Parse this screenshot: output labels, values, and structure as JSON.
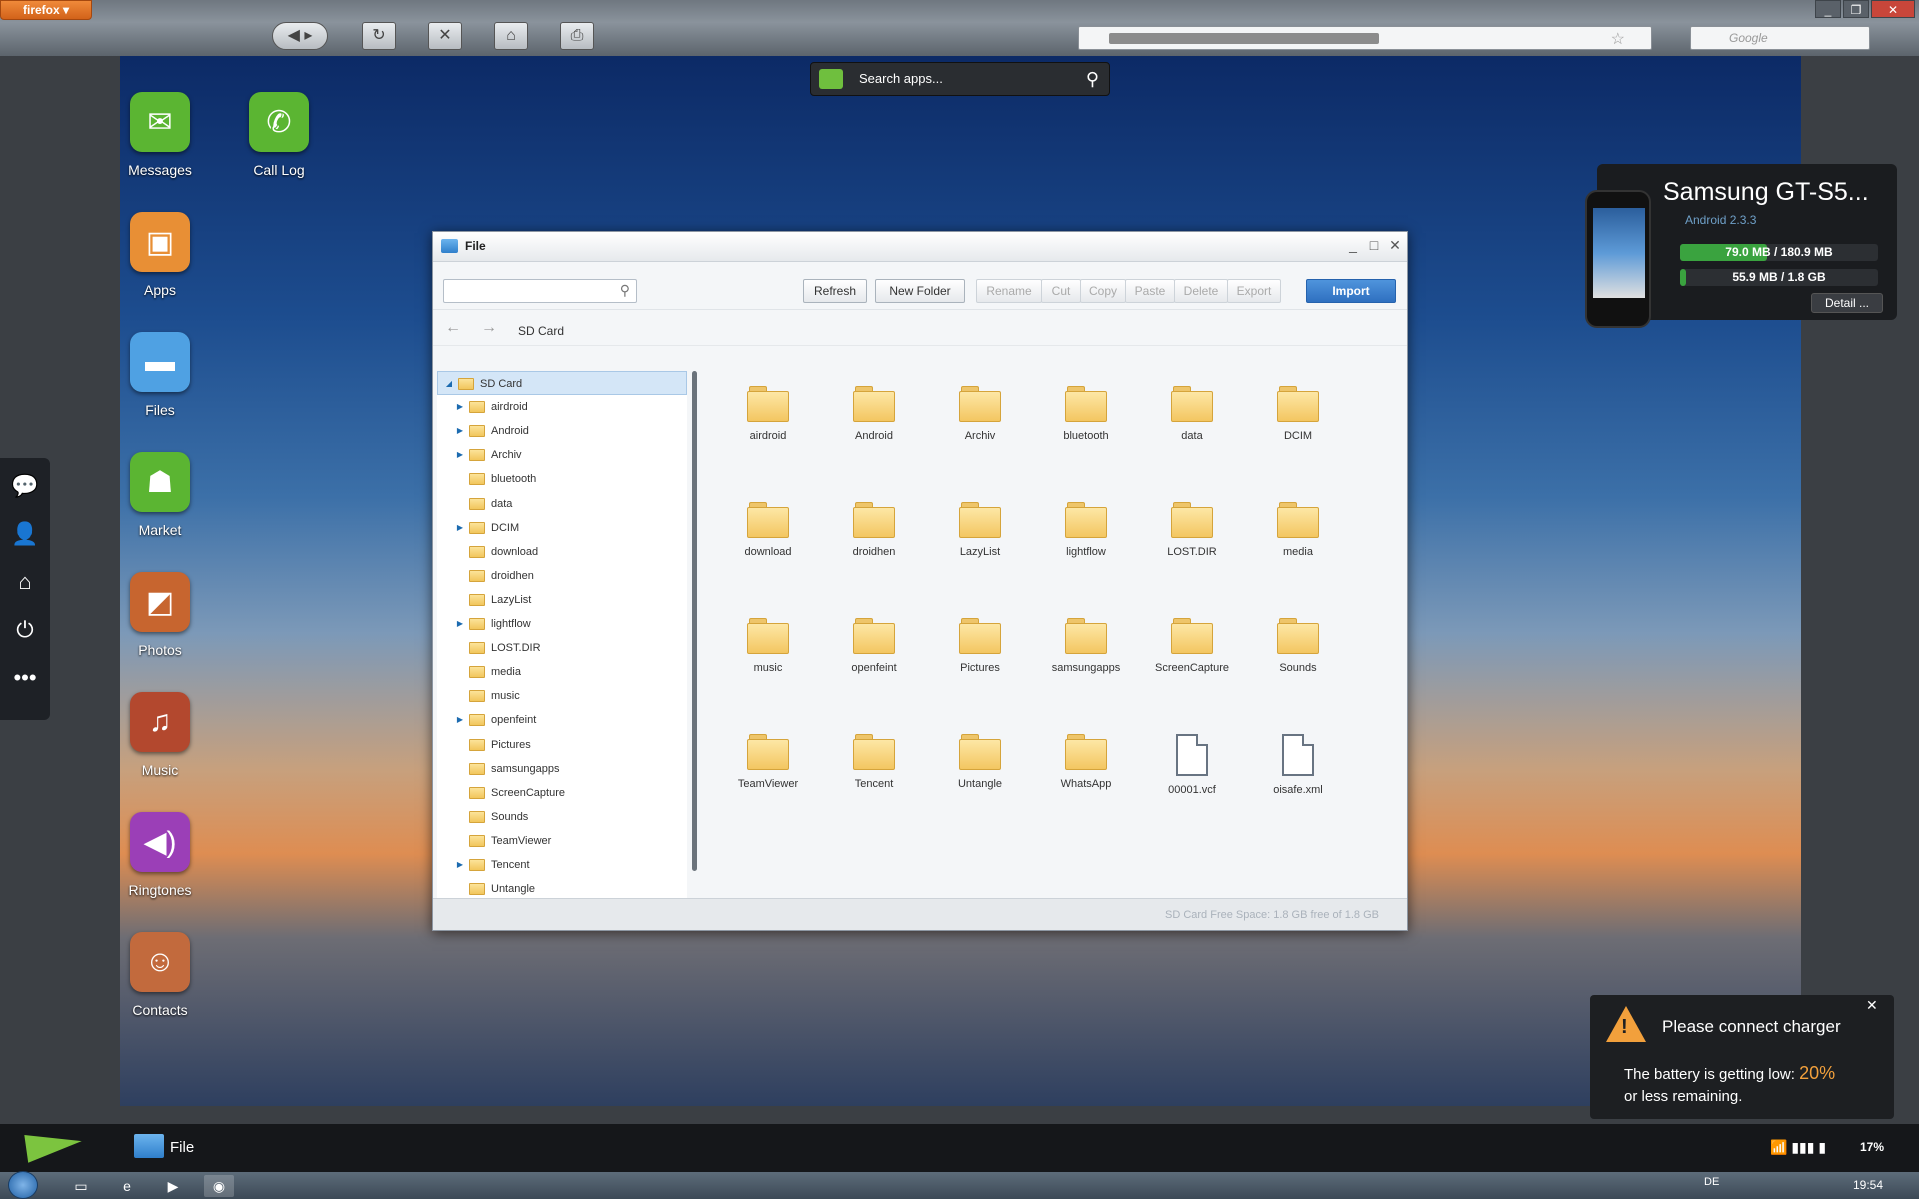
{
  "browser": {
    "menu_label": "firefox ▾",
    "search_placeholder": "Google"
  },
  "desktop": {
    "apps": [
      {
        "label": "Messages",
        "icon": "messages-icon",
        "color": "#5bb532"
      },
      {
        "label": "Call Log",
        "icon": "phone-icon",
        "color": "#5bb532"
      },
      {
        "label": "Apps",
        "icon": "box-icon",
        "color": "#e88f35"
      },
      {
        "label": "Files",
        "icon": "folder-icon",
        "color": "#4fa1e3"
      },
      {
        "label": "Market",
        "icon": "market-icon",
        "color": "#5bb532"
      },
      {
        "label": "Photos",
        "icon": "photos-icon",
        "color": "#c7652f"
      },
      {
        "label": "Music",
        "icon": "music-icon",
        "color": "#b3482e"
      },
      {
        "label": "Ringtones",
        "icon": "speaker-icon",
        "color": "#9b3fb7"
      },
      {
        "label": "Contacts",
        "icon": "contacts-icon",
        "color": "#c26a3d"
      }
    ],
    "search_apps_placeholder": "Search apps..."
  },
  "dock": {
    "items": [
      "chat-icon",
      "add-contact-icon",
      "home-icon",
      "power-icon",
      "more-icon"
    ]
  },
  "device": {
    "name": "Samsung GT-S5...",
    "os": "Android 2.3.3",
    "storage_phone": "79.0 MB / 180.9 MB",
    "storage_phone_fraction": 0.44,
    "storage_sd": "55.9 MB / 1.8 GB",
    "storage_sd_fraction": 0.03,
    "detail_label": "Detail ..."
  },
  "file_window": {
    "title": "File",
    "toolbar": {
      "refresh": "Refresh",
      "new_folder": "New Folder",
      "rename": "Rename",
      "cut": "Cut",
      "copy": "Copy",
      "paste": "Paste",
      "delete": "Delete",
      "export": "Export",
      "import": "Import"
    },
    "breadcrumb": "SD Card",
    "tree": [
      {
        "label": "SD Card",
        "expandable": true,
        "expanded": true,
        "selected": true,
        "level": 0
      },
      {
        "label": "airdroid",
        "expandable": true,
        "level": 1
      },
      {
        "label": "Android",
        "expandable": true,
        "level": 1
      },
      {
        "label": "Archiv",
        "expandable": true,
        "level": 1
      },
      {
        "label": "bluetooth",
        "expandable": false,
        "level": 1
      },
      {
        "label": "data",
        "expandable": false,
        "level": 1
      },
      {
        "label": "DCIM",
        "expandable": true,
        "level": 1
      },
      {
        "label": "download",
        "expandable": false,
        "level": 1
      },
      {
        "label": "droidhen",
        "expandable": false,
        "level": 1
      },
      {
        "label": "LazyList",
        "expandable": false,
        "level": 1
      },
      {
        "label": "lightflow",
        "expandable": true,
        "level": 1
      },
      {
        "label": "LOST.DIR",
        "expandable": false,
        "level": 1
      },
      {
        "label": "media",
        "expandable": false,
        "level": 1
      },
      {
        "label": "music",
        "expandable": false,
        "level": 1
      },
      {
        "label": "openfeint",
        "expandable": true,
        "level": 1
      },
      {
        "label": "Pictures",
        "expandable": false,
        "level": 1
      },
      {
        "label": "samsungapps",
        "expandable": false,
        "level": 1
      },
      {
        "label": "ScreenCapture",
        "expandable": false,
        "level": 1
      },
      {
        "label": "Sounds",
        "expandable": false,
        "level": 1
      },
      {
        "label": "TeamViewer",
        "expandable": false,
        "level": 1
      },
      {
        "label": "Tencent",
        "expandable": true,
        "level": 1
      },
      {
        "label": "Untangle",
        "expandable": false,
        "level": 1
      }
    ],
    "items": [
      {
        "label": "airdroid",
        "type": "folder"
      },
      {
        "label": "Android",
        "type": "folder"
      },
      {
        "label": "Archiv",
        "type": "folder"
      },
      {
        "label": "bluetooth",
        "type": "folder"
      },
      {
        "label": "data",
        "type": "folder"
      },
      {
        "label": "DCIM",
        "type": "folder"
      },
      {
        "label": "download",
        "type": "folder"
      },
      {
        "label": "droidhen",
        "type": "folder"
      },
      {
        "label": "LazyList",
        "type": "folder"
      },
      {
        "label": "lightflow",
        "type": "folder"
      },
      {
        "label": "LOST.DIR",
        "type": "folder"
      },
      {
        "label": "media",
        "type": "folder"
      },
      {
        "label": "music",
        "type": "folder"
      },
      {
        "label": "openfeint",
        "type": "folder"
      },
      {
        "label": "Pictures",
        "type": "folder"
      },
      {
        "label": "samsungapps",
        "type": "folder"
      },
      {
        "label": "ScreenCapture",
        "type": "folder"
      },
      {
        "label": "Sounds",
        "type": "folder"
      },
      {
        "label": "TeamViewer",
        "type": "folder"
      },
      {
        "label": "Tencent",
        "type": "folder"
      },
      {
        "label": "Untangle",
        "type": "folder"
      },
      {
        "label": "WhatsApp",
        "type": "folder"
      },
      {
        "label": "00001.vcf",
        "type": "file"
      },
      {
        "label": "oisafe.xml",
        "type": "file"
      }
    ],
    "footer": "SD Card Free Space: 1.8 GB free of 1.8 GB"
  },
  "battery_notice": {
    "title": "Please connect charger",
    "text_before": "The battery is getting low:",
    "percent": "20%",
    "text_after": "or less remaining."
  },
  "airdroid_taskbar": {
    "task_label": "File",
    "battery_level": "17%"
  },
  "windows_taskbar": {
    "language": "DE",
    "clock": "19:54"
  }
}
